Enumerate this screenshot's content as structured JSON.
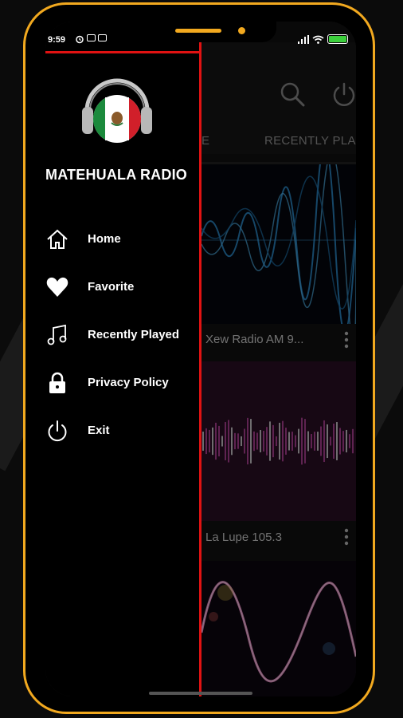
{
  "status_bar": {
    "time": "9:59"
  },
  "app_bar": {
    "tabs": [
      {
        "label": "E"
      },
      {
        "label": "RECENTLY PLA"
      }
    ],
    "icons": [
      "search-icon",
      "power-icon"
    ]
  },
  "stations": [
    {
      "title": "Xew Radio AM 9...",
      "art_color": "#3fa7e8"
    },
    {
      "title": "La Lupe 105.3",
      "art_color": "#c64aa8"
    },
    {
      "title": "",
      "art_color": "#e0408a"
    }
  ],
  "drawer": {
    "app_name": "MATEHUALA RADIO",
    "menu": [
      {
        "label": "Home",
        "icon": "home-icon"
      },
      {
        "label": "Favorite",
        "icon": "heart-icon"
      },
      {
        "label": "Recently Played",
        "icon": "music-note-icon"
      },
      {
        "label": "Privacy Policy",
        "icon": "lock-icon"
      },
      {
        "label": "Exit",
        "icon": "power-icon"
      }
    ]
  },
  "colors": {
    "phone_frame": "#f2a91f",
    "drawer_accent": "#e01212",
    "battery": "#3ccf3c",
    "flag_green": "#1b8a3c",
    "flag_red": "#d11f2a"
  }
}
